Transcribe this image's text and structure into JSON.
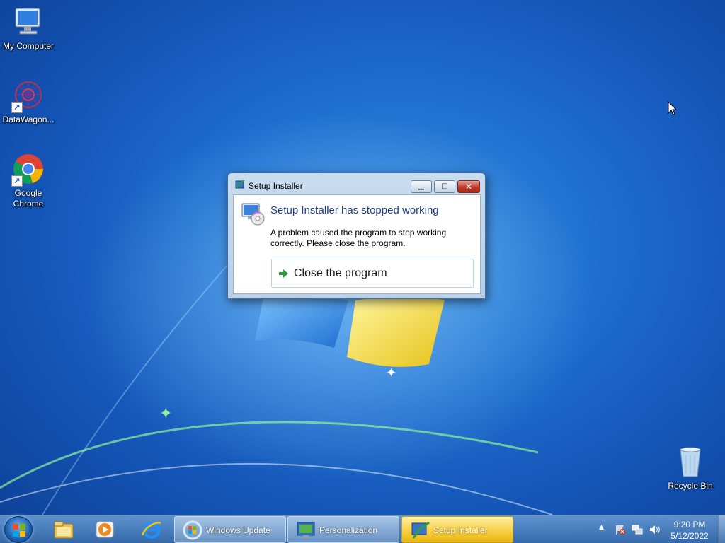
{
  "desktop": {
    "icons": [
      {
        "label": "My Computer",
        "icon": "computer-icon"
      },
      {
        "label": "DataWagon...",
        "icon": "datawagon-icon"
      },
      {
        "label": "Google Chrome",
        "icon": "chrome-icon"
      },
      {
        "label": "Recycle Bin",
        "icon": "recycle-bin-icon"
      }
    ]
  },
  "dialog": {
    "title": "Setup Installer",
    "heading": "Setup Installer has stopped working",
    "message": "A problem caused the program to stop working correctly. Please close the program.",
    "command_link": "Close the program",
    "buttons": {
      "minimize": "▁",
      "maximize": "□",
      "close": "✕"
    }
  },
  "taskbar": {
    "pinned": [
      "windows-explorer-icon",
      "media-player-icon",
      "internet-explorer-icon"
    ],
    "tasks": [
      {
        "label": "Windows Update",
        "active": false
      },
      {
        "label": "Personalization",
        "active": false
      },
      {
        "label": "Setup Installer",
        "active": true
      }
    ],
    "tray": {
      "expand": "▲",
      "time": "9:20 PM",
      "date": "5/12/2022"
    }
  },
  "colors": {
    "desktop_blue": "#1f6fd0",
    "active_task": "#f6cd3c",
    "dialog_heading": "#1e3a8a",
    "close_button": "#c0392b"
  }
}
